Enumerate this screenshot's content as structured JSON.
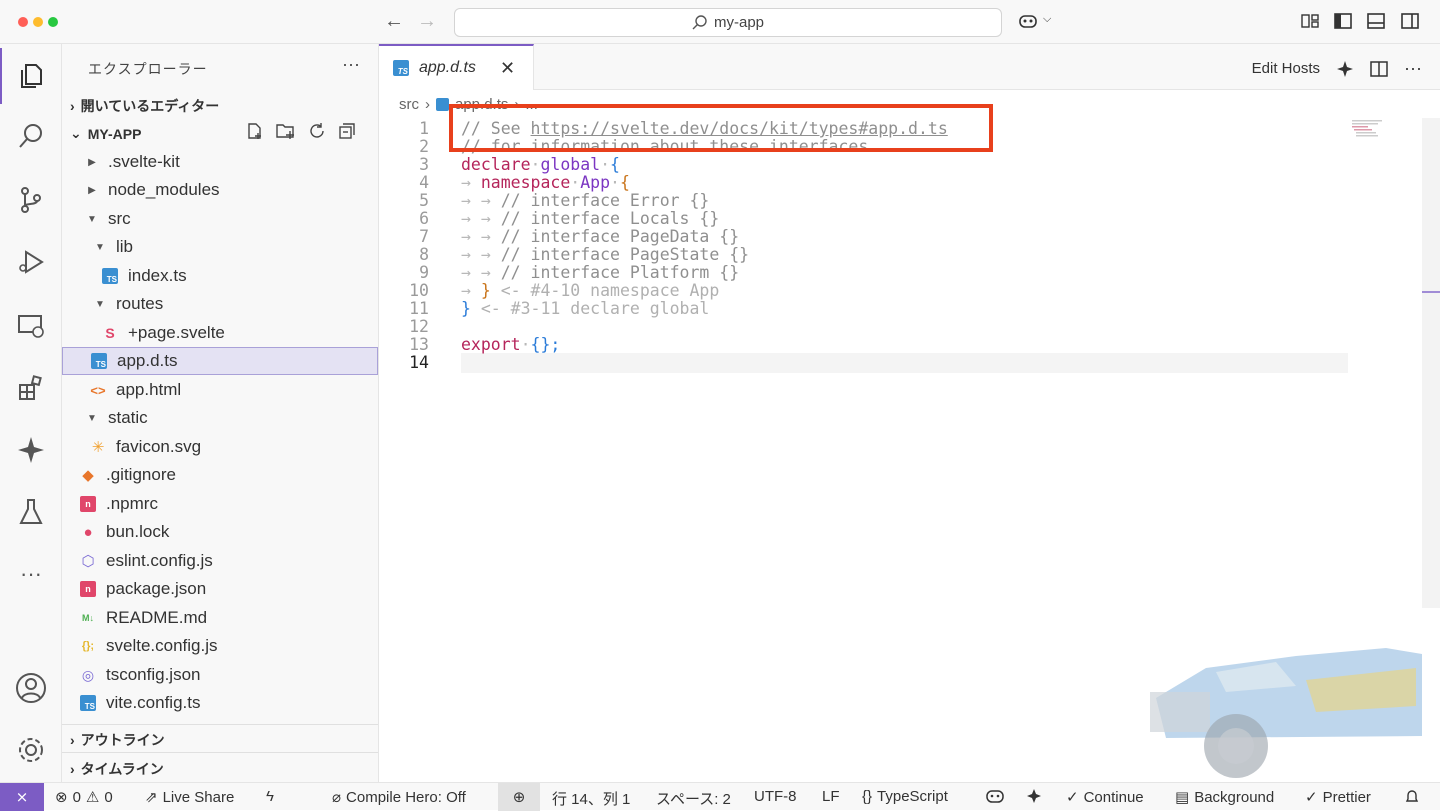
{
  "window": {
    "search_text": "my-app"
  },
  "sidebar": {
    "title": "エクスプローラー",
    "open_editors": "開いているエディター",
    "project": "MY-APP",
    "tree": [
      {
        "label": ".svelte-kit",
        "icon": "folder"
      },
      {
        "label": "node_modules",
        "icon": "folder"
      },
      {
        "label": "src",
        "icon": "folder-open"
      },
      {
        "label": "lib",
        "icon": "folder-open"
      },
      {
        "label": "index.ts",
        "icon": "typescript-icon"
      },
      {
        "label": "routes",
        "icon": "folder-open"
      },
      {
        "label": "+page.svelte",
        "icon": "svelte-icon"
      },
      {
        "label": "app.d.ts",
        "icon": "typescript-icon"
      },
      {
        "label": "app.html",
        "icon": "html-icon"
      },
      {
        "label": "static",
        "icon": "folder-open"
      },
      {
        "label": "favicon.svg",
        "icon": "svg-icon"
      },
      {
        "label": ".gitignore",
        "icon": "git-icon"
      },
      {
        "label": ".npmrc",
        "icon": "npm-icon"
      },
      {
        "label": "bun.lock",
        "icon": "bun-icon"
      },
      {
        "label": "eslint.config.js",
        "icon": "eslint-icon"
      },
      {
        "label": "package.json",
        "icon": "npm-icon"
      },
      {
        "label": "README.md",
        "icon": "markdown-icon"
      },
      {
        "label": "svelte.config.js",
        "icon": "js-icon"
      },
      {
        "label": "tsconfig.json",
        "icon": "tsconfig-icon"
      },
      {
        "label": "vite.config.ts",
        "icon": "typescript-icon"
      }
    ],
    "outline": "アウトライン",
    "timeline": "タイムライン"
  },
  "editor": {
    "tab_label": "app.d.ts",
    "edit_hosts": "Edit Hosts",
    "breadcrumb": [
      "src",
      "app.d.ts",
      "..."
    ],
    "line_numbers": [
      "1",
      "2",
      "3",
      "4",
      "5",
      "6",
      "7",
      "8",
      "9",
      "10",
      "11",
      "12",
      "13",
      "14"
    ],
    "code": {
      "l1_prefix": "// See ",
      "l1_link": "https://svelte.dev/docs/kit/types#app.d.ts",
      "l2": "// for information about these interfaces",
      "l3_kw": "declare",
      "l3_ty": "global",
      "l4_kw": "namespace",
      "l4_ty": "App",
      "l5": "// interface Error {}",
      "l6": "// interface Locals {}",
      "l7": "// interface PageData {}",
      "l8": "// interface PageState {}",
      "l9": "// interface Platform {}",
      "l10_hint": "<- #4-10 namespace App",
      "l11_hint": "<- #3-11 declare global",
      "l13_kw": "export",
      "l13_rest": "{};"
    }
  },
  "status": {
    "problems_errors": "0",
    "problems_warnings": "0",
    "live_share": "Live Share",
    "compile_hero": "Compile Hero: Off",
    "position": "行 14、列 1",
    "spaces": "スペース: 2",
    "encoding": "UTF-8",
    "eol": "LF",
    "language_braces": "{}",
    "language": "TypeScript",
    "continue": "Continue",
    "background": "Background",
    "prettier": "Prettier"
  },
  "colors": {
    "accent": "#7c5cc4",
    "highlight": "#e8401c"
  }
}
